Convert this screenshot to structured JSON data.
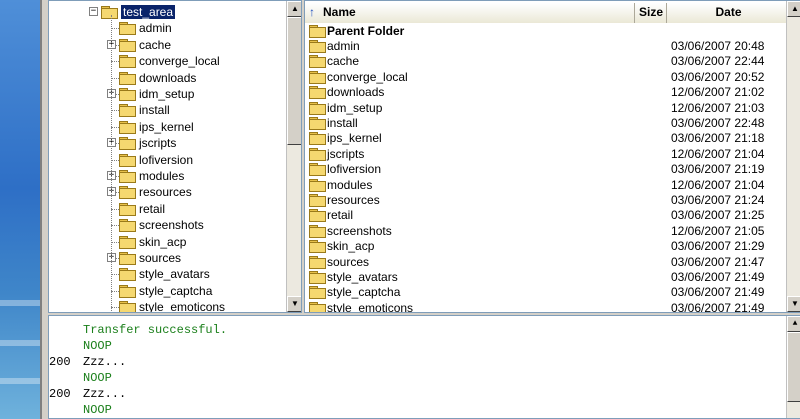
{
  "tree": {
    "selected": "test_area",
    "items": [
      {
        "label": "test_area",
        "expander": "−",
        "selected": true
      },
      {
        "label": "admin",
        "expander": ""
      },
      {
        "label": "cache",
        "expander": "+"
      },
      {
        "label": "converge_local",
        "expander": ""
      },
      {
        "label": "downloads",
        "expander": ""
      },
      {
        "label": "idm_setup",
        "expander": "+"
      },
      {
        "label": "install",
        "expander": ""
      },
      {
        "label": "ips_kernel",
        "expander": ""
      },
      {
        "label": "jscripts",
        "expander": "+"
      },
      {
        "label": "lofiversion",
        "expander": ""
      },
      {
        "label": "modules",
        "expander": "+"
      },
      {
        "label": "resources",
        "expander": "+"
      },
      {
        "label": "retail",
        "expander": ""
      },
      {
        "label": "screenshots",
        "expander": ""
      },
      {
        "label": "skin_acp",
        "expander": ""
      },
      {
        "label": "sources",
        "expander": "+"
      },
      {
        "label": "style_avatars",
        "expander": ""
      },
      {
        "label": "style_captcha",
        "expander": ""
      },
      {
        "label": "style_emoticons",
        "expander": ""
      }
    ]
  },
  "list": {
    "columns": {
      "name": "Name",
      "size": "Size",
      "date": "Date"
    },
    "up_icon": "↑",
    "parent_label": "Parent Folder",
    "rows": [
      {
        "name": "admin",
        "date": "03/06/2007 20:48"
      },
      {
        "name": "cache",
        "date": "03/06/2007 22:44"
      },
      {
        "name": "converge_local",
        "date": "03/06/2007 20:52"
      },
      {
        "name": "downloads",
        "date": "12/06/2007 21:02"
      },
      {
        "name": "idm_setup",
        "date": "12/06/2007 21:03"
      },
      {
        "name": "install",
        "date": "03/06/2007 22:48"
      },
      {
        "name": "ips_kernel",
        "date": "03/06/2007 21:18"
      },
      {
        "name": "jscripts",
        "date": "12/06/2007 21:04"
      },
      {
        "name": "lofiversion",
        "date": "03/06/2007 21:19"
      },
      {
        "name": "modules",
        "date": "12/06/2007 21:04"
      },
      {
        "name": "resources",
        "date": "03/06/2007 21:24"
      },
      {
        "name": "retail",
        "date": "03/06/2007 21:25"
      },
      {
        "name": "screenshots",
        "date": "12/06/2007 21:05"
      },
      {
        "name": "skin_acp",
        "date": "03/06/2007 21:29"
      },
      {
        "name": "sources",
        "date": "03/06/2007 21:47"
      },
      {
        "name": "style_avatars",
        "date": "03/06/2007 21:49"
      },
      {
        "name": "style_captcha",
        "date": "03/06/2007 21:49"
      },
      {
        "name": "style_emoticons",
        "date": "03/06/2007 21:49"
      }
    ]
  },
  "log": {
    "lines": [
      {
        "code": "",
        "msg": "Transfer successful.",
        "color": "green"
      },
      {
        "code": "",
        "msg": "NOOP",
        "color": "green"
      },
      {
        "code": "200",
        "msg": "Zzz...",
        "color": "black"
      },
      {
        "code": "",
        "msg": "NOOP",
        "color": "green"
      },
      {
        "code": "200",
        "msg": "Zzz...",
        "color": "black"
      },
      {
        "code": "",
        "msg": "NOOP",
        "color": "green"
      }
    ]
  },
  "scroll_arrows": {
    "up": "▲",
    "down": "▼"
  },
  "colors": {
    "selection": "#0a246a",
    "log_green": "#1a7f1a",
    "folder": "#f5d870"
  }
}
